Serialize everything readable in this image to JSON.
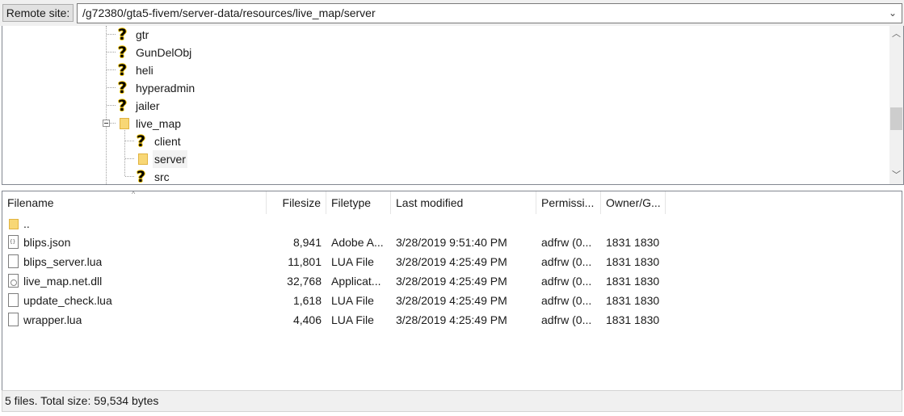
{
  "remote_site": {
    "label": "Remote site:",
    "path": "/g72380/gta5-fivem/server-data/resources/live_map/server",
    "dropdown_icon": "chevron-down-icon"
  },
  "tree": {
    "items": [
      {
        "label": "gtr",
        "icon": "unknown-folder-icon"
      },
      {
        "label": "GunDelObj",
        "icon": "unknown-folder-icon"
      },
      {
        "label": "heli",
        "icon": "unknown-folder-icon"
      },
      {
        "label": "hyperadmin",
        "icon": "unknown-folder-icon"
      },
      {
        "label": "jailer",
        "icon": "unknown-folder-icon"
      },
      {
        "label": "live_map",
        "icon": "folder-icon",
        "expanded": true
      },
      {
        "label": "client",
        "icon": "unknown-folder-icon"
      },
      {
        "label": "server",
        "icon": "folder-icon",
        "selected": true
      },
      {
        "label": "src",
        "icon": "unknown-folder-icon"
      }
    ],
    "scroll_up_glyph": "︿",
    "scroll_down_glyph": "﹀"
  },
  "file_list": {
    "sort_glyph": "^",
    "columns": {
      "filename": "Filename",
      "filesize": "Filesize",
      "filetype": "Filetype",
      "last_modified": "Last modified",
      "permissions": "Permissi...",
      "owner": "Owner/G..."
    },
    "parent_dir": "..",
    "rows": [
      {
        "filename": "blips.json",
        "filesize": "8,941",
        "filetype": "Adobe A...",
        "last_modified": "3/28/2019 9:51:40 PM",
        "permissions": "adfrw (0...",
        "owner": "1831 1830",
        "icon": "json-file-icon"
      },
      {
        "filename": "blips_server.lua",
        "filesize": "11,801",
        "filetype": "LUA File",
        "last_modified": "3/28/2019 4:25:49 PM",
        "permissions": "adfrw (0...",
        "owner": "1831 1830",
        "icon": "file-icon"
      },
      {
        "filename": "live_map.net.dll",
        "filesize": "32,768",
        "filetype": "Applicat...",
        "last_modified": "3/28/2019 4:25:49 PM",
        "permissions": "adfrw (0...",
        "owner": "1831 1830",
        "icon": "dll-file-icon"
      },
      {
        "filename": "update_check.lua",
        "filesize": "1,618",
        "filetype": "LUA File",
        "last_modified": "3/28/2019 4:25:49 PM",
        "permissions": "adfrw (0...",
        "owner": "1831 1830",
        "icon": "file-icon"
      },
      {
        "filename": "wrapper.lua",
        "filesize": "4,406",
        "filetype": "LUA File",
        "last_modified": "3/28/2019 4:25:49 PM",
        "permissions": "adfrw (0...",
        "owner": "1831 1830",
        "icon": "file-icon"
      }
    ]
  },
  "status_bar": {
    "text": "5 files. Total size: 59,534 bytes"
  }
}
